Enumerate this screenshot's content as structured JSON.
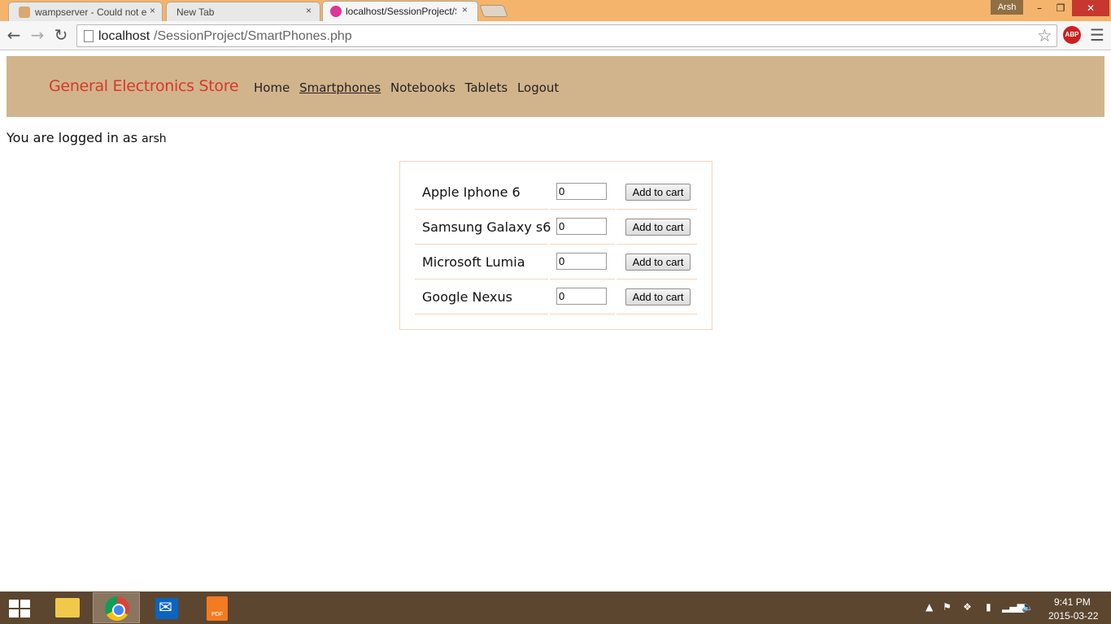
{
  "browser": {
    "tabs": [
      {
        "title": "wampserver - Could not e",
        "close": "×"
      },
      {
        "title": "New Tab",
        "close": "×"
      },
      {
        "title": "localhost/SessionProject/S",
        "close": "×"
      }
    ],
    "user_badge": "Arsh",
    "window_controls": {
      "minimize": "–",
      "restore": "❐",
      "close": "✕"
    },
    "address": {
      "host": "localhost",
      "path": "/SessionProject/SmartPhones.php"
    },
    "extension_label": "ABP"
  },
  "site": {
    "brand": "General Electronics Store",
    "brand_color": "#d8382a",
    "header_color": "#d2b48c",
    "nav": [
      {
        "label": "Home",
        "current": false
      },
      {
        "label": "Smartphones",
        "current": true
      },
      {
        "label": "Notebooks",
        "current": false
      },
      {
        "label": "Tablets",
        "current": false
      },
      {
        "label": "Logout",
        "current": false
      }
    ],
    "login_prefix": "You are logged in as",
    "login_user": "arsh"
  },
  "products": [
    {
      "name": "Apple Iphone 6",
      "qty": "0",
      "button": "Add to cart"
    },
    {
      "name": "Samsung Galaxy s6",
      "qty": "0",
      "button": "Add to cart"
    },
    {
      "name": "Microsoft Lumia",
      "qty": "0",
      "button": "Add to cart"
    },
    {
      "name": "Google Nexus",
      "qty": "0",
      "button": "Add to cart"
    }
  ],
  "taskbar": {
    "pdf_label": "PDF",
    "clock_time": "9:41 PM",
    "clock_date": "2015-03-22",
    "taskbar_color": "#5c4630"
  },
  "icons": [
    "back-icon",
    "forward-icon",
    "reload-icon",
    "page-icon",
    "star-icon",
    "menu-icon",
    "windows-start-icon",
    "file-explorer-icon",
    "chrome-icon",
    "mail-icon",
    "pdf-icon"
  ]
}
